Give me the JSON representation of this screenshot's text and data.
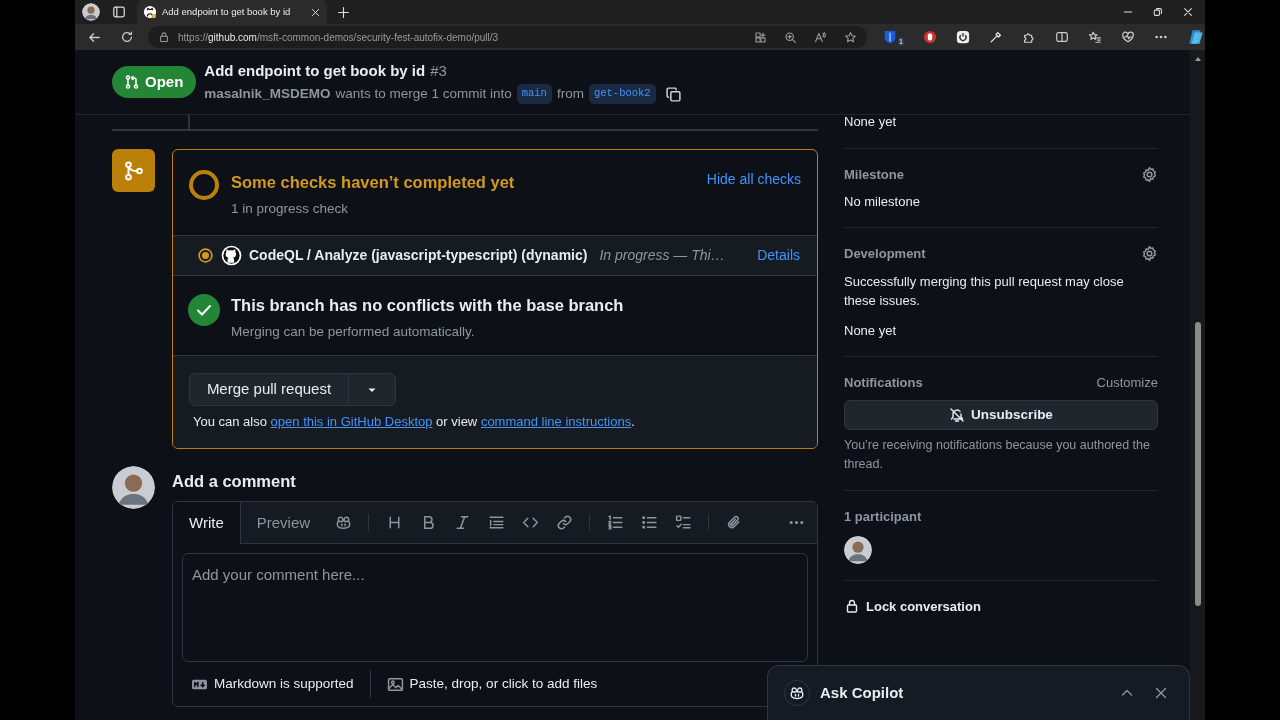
{
  "browser": {
    "tab_title": "Add endpoint to get book by id",
    "url_host": "https://github.com",
    "url_path": "/msft-common-demos/security-fest-autofix-demo/pull/3",
    "extension_badge": "1"
  },
  "pr": {
    "state": "Open",
    "title": "Add endpoint to get book by id",
    "number": "#3",
    "author": "masalnik_MSDEMO",
    "summary": "wants to merge 1 commit into",
    "base": "main",
    "from": "from",
    "head": "get-book2"
  },
  "checks": {
    "completed": false,
    "title": "Some checks haven’t completed yet",
    "subtitle": "1 in progress check",
    "toggle": "Hide all checks",
    "items": [
      {
        "in_progress": true,
        "name": "CodeQL / Analyze (javascript-typescript) (dynamic)",
        "status": "In progress — Thi…",
        "action": "Details"
      }
    ]
  },
  "merge_status": {
    "conflicts": false,
    "title": "This branch has no conflicts with the base branch",
    "subtitle": "Merging can be performed automatically."
  },
  "merge": {
    "button": "Merge pull request",
    "note_parts": [
      {
        "kind": "text",
        "text": "You can also "
      },
      {
        "kind": "link",
        "text": "open this in GitHub Desktop"
      },
      {
        "kind": "text",
        "text": " or view "
      },
      {
        "kind": "link",
        "text": "command line instructions"
      },
      {
        "kind": "text",
        "text": "."
      }
    ]
  },
  "comment": {
    "heading": "Add a comment",
    "tabs": [
      {
        "label": "Write",
        "selected": true
      },
      {
        "label": "Preview",
        "selected": false
      }
    ],
    "placeholder": "Add your comment here...",
    "footer": [
      "Markdown is supported",
      "Paste, drop, or click to add files"
    ]
  },
  "sidebar": [
    {
      "kind": "tail",
      "values": [
        "None yet"
      ]
    },
    {
      "kind": "setting",
      "heading": "Milestone",
      "values": [
        "No milestone"
      ]
    },
    {
      "kind": "setting",
      "heading": "Development",
      "values": [
        "Successfully merging this pull request may close these issues.",
        "None yet"
      ]
    },
    {
      "kind": "notifications",
      "heading": "Notifications",
      "action": "Customize",
      "button": "Unsubscribe",
      "note": "You’re receiving notifications because you authored the thread."
    },
    {
      "kind": "participants",
      "heading": "1 participant"
    },
    {
      "kind": "lock",
      "label": "Lock conversation"
    }
  ],
  "copilot": {
    "title": "Ask Copilot"
  }
}
